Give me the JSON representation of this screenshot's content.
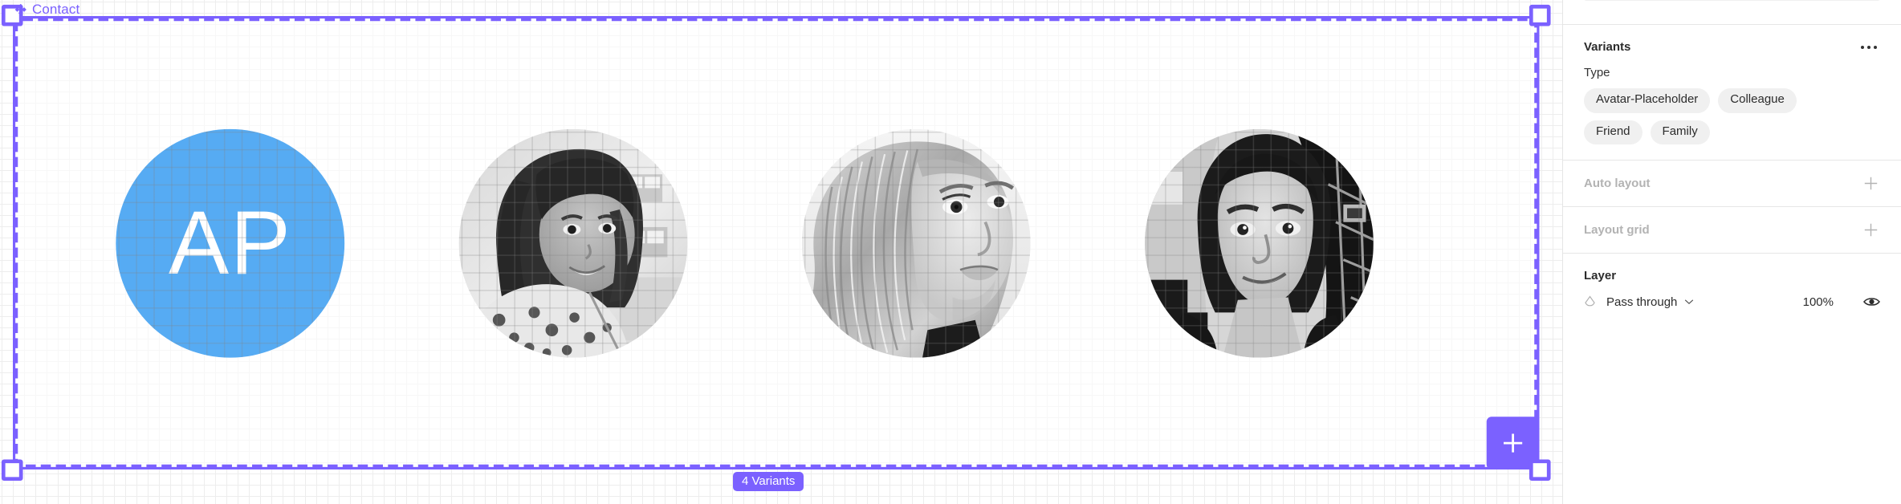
{
  "canvas": {
    "component_title": "Contact",
    "component_icon": "component-diamond-icon",
    "variants_badge": "4 Variants",
    "add_variant_icon": "plus-icon",
    "avatars": [
      {
        "type": "initials",
        "initials": "AP",
        "color": "#56ABF3",
        "name": "avatar-placeholder"
      },
      {
        "type": "photo",
        "name": "avatar-colleague",
        "alt": "Portrait of a woman with dark fringe"
      },
      {
        "type": "photo",
        "name": "avatar-friend",
        "alt": "Portrait of a blonde woman"
      },
      {
        "type": "photo",
        "name": "avatar-family",
        "alt": "Portrait of a man"
      }
    ]
  },
  "panel": {
    "variants": {
      "title": "Variants",
      "more_icon": "dots-horizontal-icon",
      "property_label": "Type",
      "chips": [
        [
          "Avatar-Placeholder",
          "Colleague"
        ],
        [
          "Friend",
          "Family"
        ]
      ]
    },
    "auto_layout": {
      "label": "Auto layout",
      "add_icon": "plus-icon"
    },
    "layout_grid": {
      "label": "Layout grid",
      "add_icon": "plus-icon"
    },
    "layer": {
      "title": "Layer",
      "blend_icon": "blend-mode-icon",
      "blend_mode": "Pass through",
      "chevron_icon": "chevron-down-icon",
      "opacity": "100%",
      "visibility_icon": "eye-icon"
    }
  },
  "colors": {
    "accent_purple": "#7B61FF",
    "avatar_blue": "#56ABF3",
    "chip_bg": "#f0f0f0",
    "muted_text": "#b3b3b3"
  }
}
